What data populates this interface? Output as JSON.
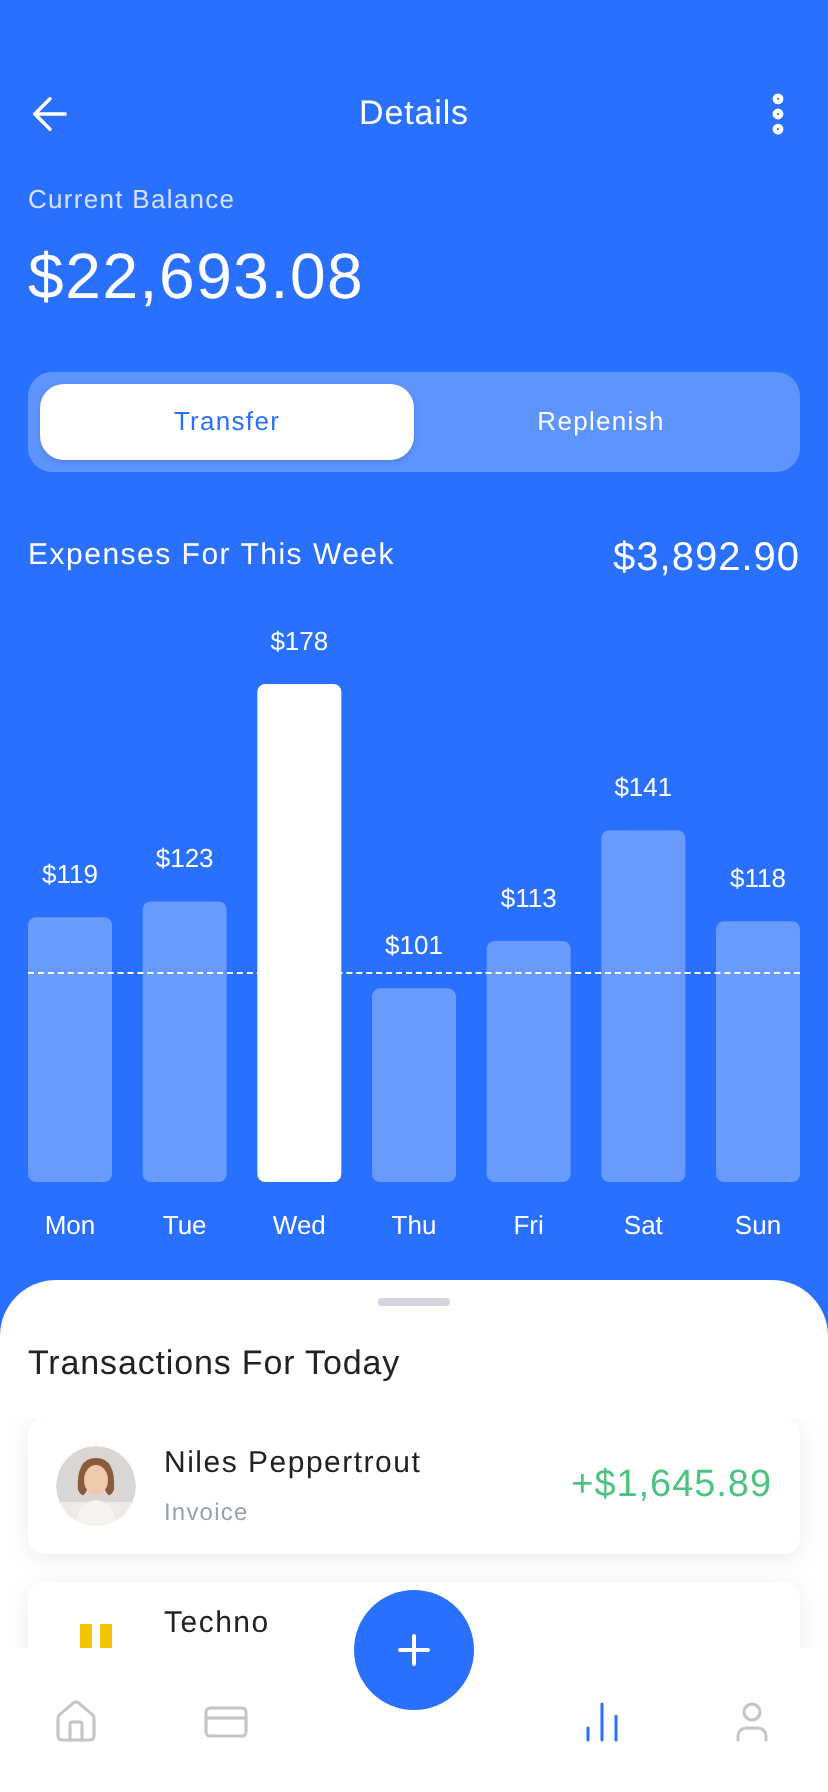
{
  "header": {
    "title": "Details"
  },
  "balance": {
    "label": "Current Balance",
    "amount": "$22,693.08"
  },
  "tabs": [
    {
      "label": "Transfer",
      "selected": true
    },
    {
      "label": "Replenish",
      "selected": false
    }
  ],
  "expenses": {
    "title": "Expenses For This Week",
    "total": "$3,892.90",
    "bars": [
      {
        "selected": false
      },
      {
        "selected": false
      },
      {
        "selected": true
      },
      {
        "selected": false
      },
      {
        "selected": false
      },
      {
        "selected": false
      },
      {
        "selected": false
      }
    ],
    "chart_data": {
      "type": "bar",
      "categories": [
        "Mon",
        "Tue",
        "Wed",
        "Thu",
        "Fri",
        "Sat",
        "Sun"
      ],
      "values": [
        119,
        123,
        178,
        101,
        113,
        141,
        118
      ],
      "value_labels": [
        "$119",
        "$123",
        "$178",
        "$101",
        "$113",
        "$141",
        "$118"
      ],
      "ylim": [
        52,
        178
      ]
    }
  },
  "transactions": {
    "title": "Transactions For Today",
    "items": [
      {
        "kind": "person",
        "name": "Niles Peppertrout",
        "subtitle": "Invoice",
        "amount": "+$1,645.89",
        "color": "#4cc47f"
      },
      {
        "kind": "company",
        "name": "Techno"
      }
    ]
  },
  "nav": [
    {
      "kind": "home",
      "selected": false
    },
    {
      "kind": "card",
      "selected": false
    },
    {
      "kind": "add",
      "selected": false
    },
    {
      "kind": "stats",
      "selected": true
    },
    {
      "kind": "profile",
      "selected": false
    }
  ]
}
